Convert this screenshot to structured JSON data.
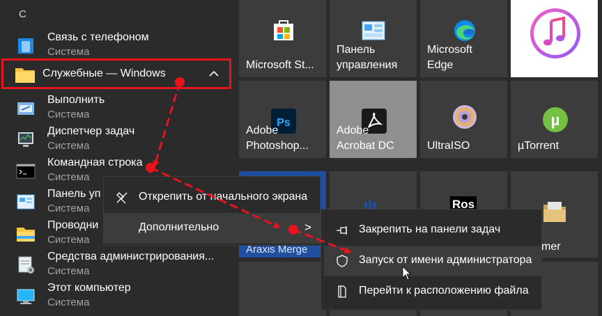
{
  "app_list": {
    "letter": "С",
    "items": [
      {
        "title": "Связь с телефоном",
        "sub": "Система"
      },
      {
        "title": "Служебные — Windows"
      },
      {
        "title": "Выполнить",
        "sub": "Система"
      },
      {
        "title": "Диспетчер задач",
        "sub": "Система"
      },
      {
        "title": "Командная строка",
        "sub": "Система"
      },
      {
        "title": "Панель уп",
        "sub": "Система"
      },
      {
        "title": "Проводни",
        "sub": "Система"
      },
      {
        "title": "Средства администрирования...",
        "sub": "Система"
      },
      {
        "title": "Этот компьютер",
        "sub": "Система"
      }
    ]
  },
  "tiles": {
    "microsoft_store": "Microsoft St...",
    "control_panel": "Панель\nуправления",
    "edge": "Microsoft\nEdge",
    "photoshop": "Adobe\nPhotoshop...",
    "acrobat": "Adobe\nAcrobat DC",
    "ultraiso": "UltraISO",
    "utorrent": "µTorrent",
    "araxis": "Araxis Merge",
    "partial": "mer",
    "partial2": "Ros"
  },
  "context_menu": {
    "unpin": "Открепить от начального экрана",
    "more": "Дополнительно",
    "arrow": ">"
  },
  "submenu": {
    "pin_taskbar": "Закрепить на панели задач",
    "run_admin": "Запуск от имени администратора",
    "open_location": "Перейти к расположению файла"
  },
  "colors": {
    "annotation": "#e8141b",
    "background": "#2b2b2b",
    "tile": "#3c3c3c"
  }
}
